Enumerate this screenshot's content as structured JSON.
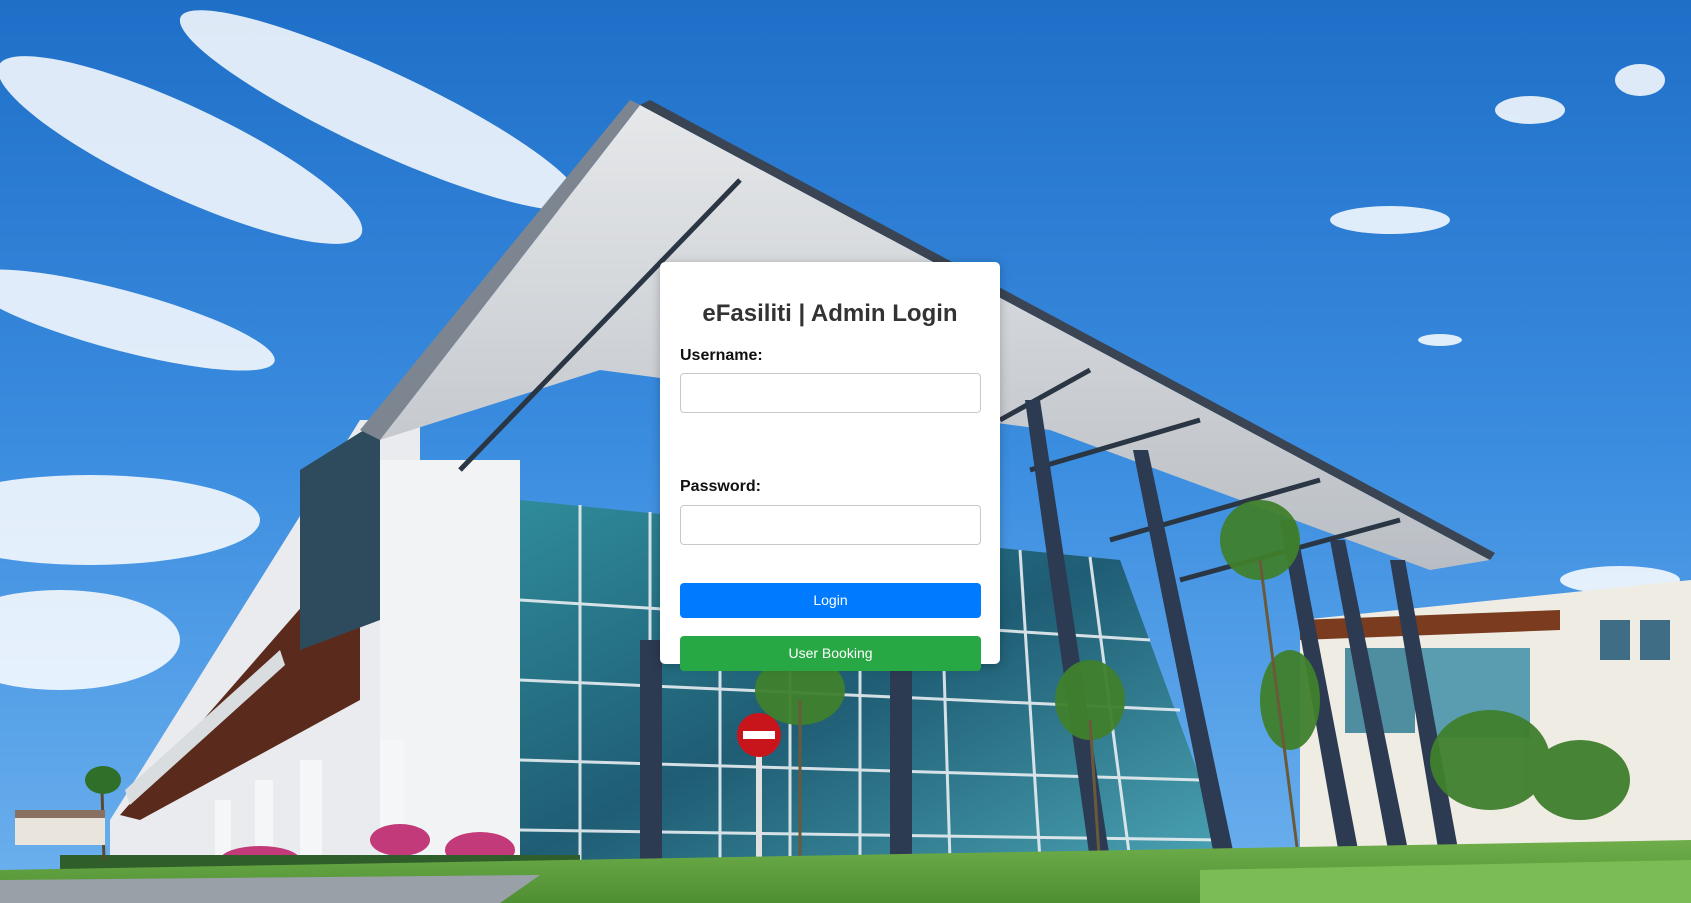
{
  "login": {
    "title": "eFasiliti | Admin Login",
    "username_label": "Username:",
    "username_value": "",
    "password_label": "Password:",
    "password_value": "",
    "login_button": "Login",
    "booking_button": "User Booking"
  },
  "colors": {
    "login_button": "#007bff",
    "booking_button": "#28a745",
    "card": "#ffffff",
    "sky": "#3d8ee0"
  }
}
